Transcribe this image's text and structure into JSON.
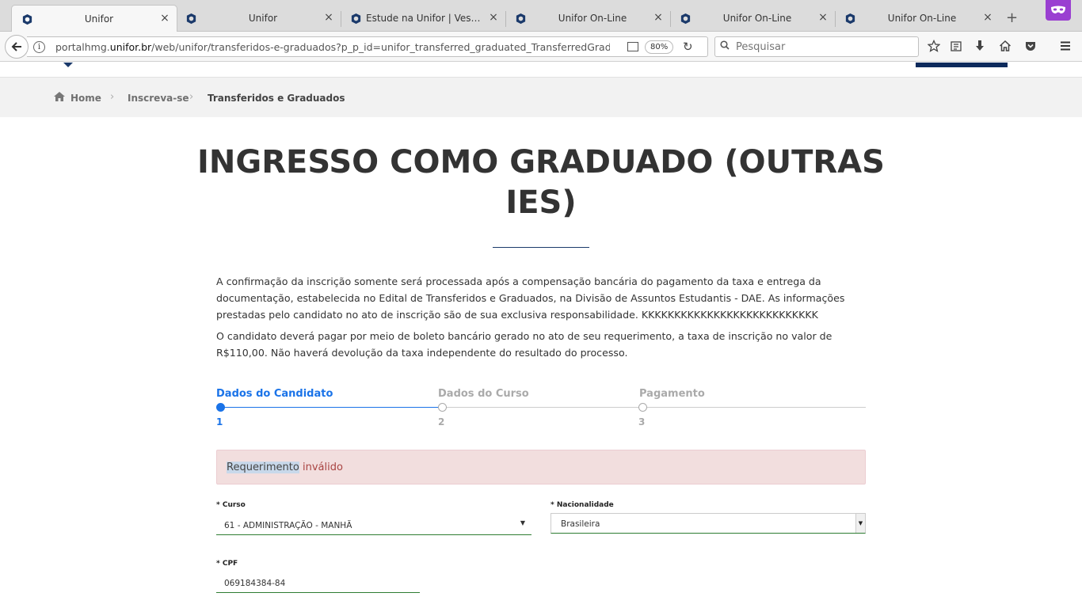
{
  "browser": {
    "tabs": [
      {
        "title": "Unifor",
        "active": true
      },
      {
        "title": "Unifor",
        "active": false
      },
      {
        "title": "Estude na Unifor | Vestibul...",
        "active": false
      },
      {
        "title": "Unifor On-Line",
        "active": false
      },
      {
        "title": "Unifor On-Line",
        "active": false
      },
      {
        "title": "Unifor On-Line",
        "active": false
      }
    ],
    "tab_close": "×",
    "new_tab": "+",
    "url_prefix": "portalhmg.",
    "url_domain": "unifor.br",
    "url_path": "/web/unifor/transferidos-e-graduados?p_p_id=unifor_transferred_graduated_TransferredGraduatedPortl",
    "zoom": "80%",
    "search_placeholder": "Pesquisar",
    "info_glyph": "i",
    "reload_glyph": "↻"
  },
  "breadcrumb": {
    "home": "Home",
    "step2": "Inscreva-se",
    "current": "Transferidos e Graduados",
    "separator": "›"
  },
  "page": {
    "title": "INGRESSO COMO GRADUADO (OUTRAS IES)",
    "paragraph1": "A confirmação da inscrição somente será processada após a compensação bancária do pagamento da taxa e entrega da documentação, estabelecida no Edital de Transferidos e Graduados, na Divisão de Assuntos Estudantis - DAE. As informações prestadas pelo candidato no ato de inscrição são de sua exclusiva responsabilidade. KKKKKKKKKKKKKKKKKKKKKKKKKKK",
    "paragraph2": "O candidato deverá pagar por meio de boleto bancário gerado no ato de seu requerimento, a taxa de inscrição no valor de R$110,00. Não haverá devolução da taxa independente do resultado do processo."
  },
  "stepper": {
    "steps": [
      {
        "label": "Dados do Candidato",
        "number": "1",
        "active": true
      },
      {
        "label": "Dados do Curso",
        "number": "2",
        "active": false
      },
      {
        "label": "Pagamento",
        "number": "3",
        "active": false
      }
    ]
  },
  "alert": {
    "highlighted": "Requerimento",
    "rest": " inválido"
  },
  "form": {
    "curso_label": "* Curso",
    "curso_value": "61 - ADMINISTRAÇÃO - MANHÃ",
    "nacionalidade_label": "* Nacionalidade",
    "nacionalidade_value": "Brasileira",
    "cpf_label": "* CPF",
    "cpf_value": "069184384-84",
    "dropdown_glyph": "▼"
  },
  "colors": {
    "accent": "#1a73e8",
    "navy": "#1b3a6b",
    "alert_bg": "#f2dede",
    "alert_text": "#a94442",
    "valid_underline": "#2e7d32"
  }
}
